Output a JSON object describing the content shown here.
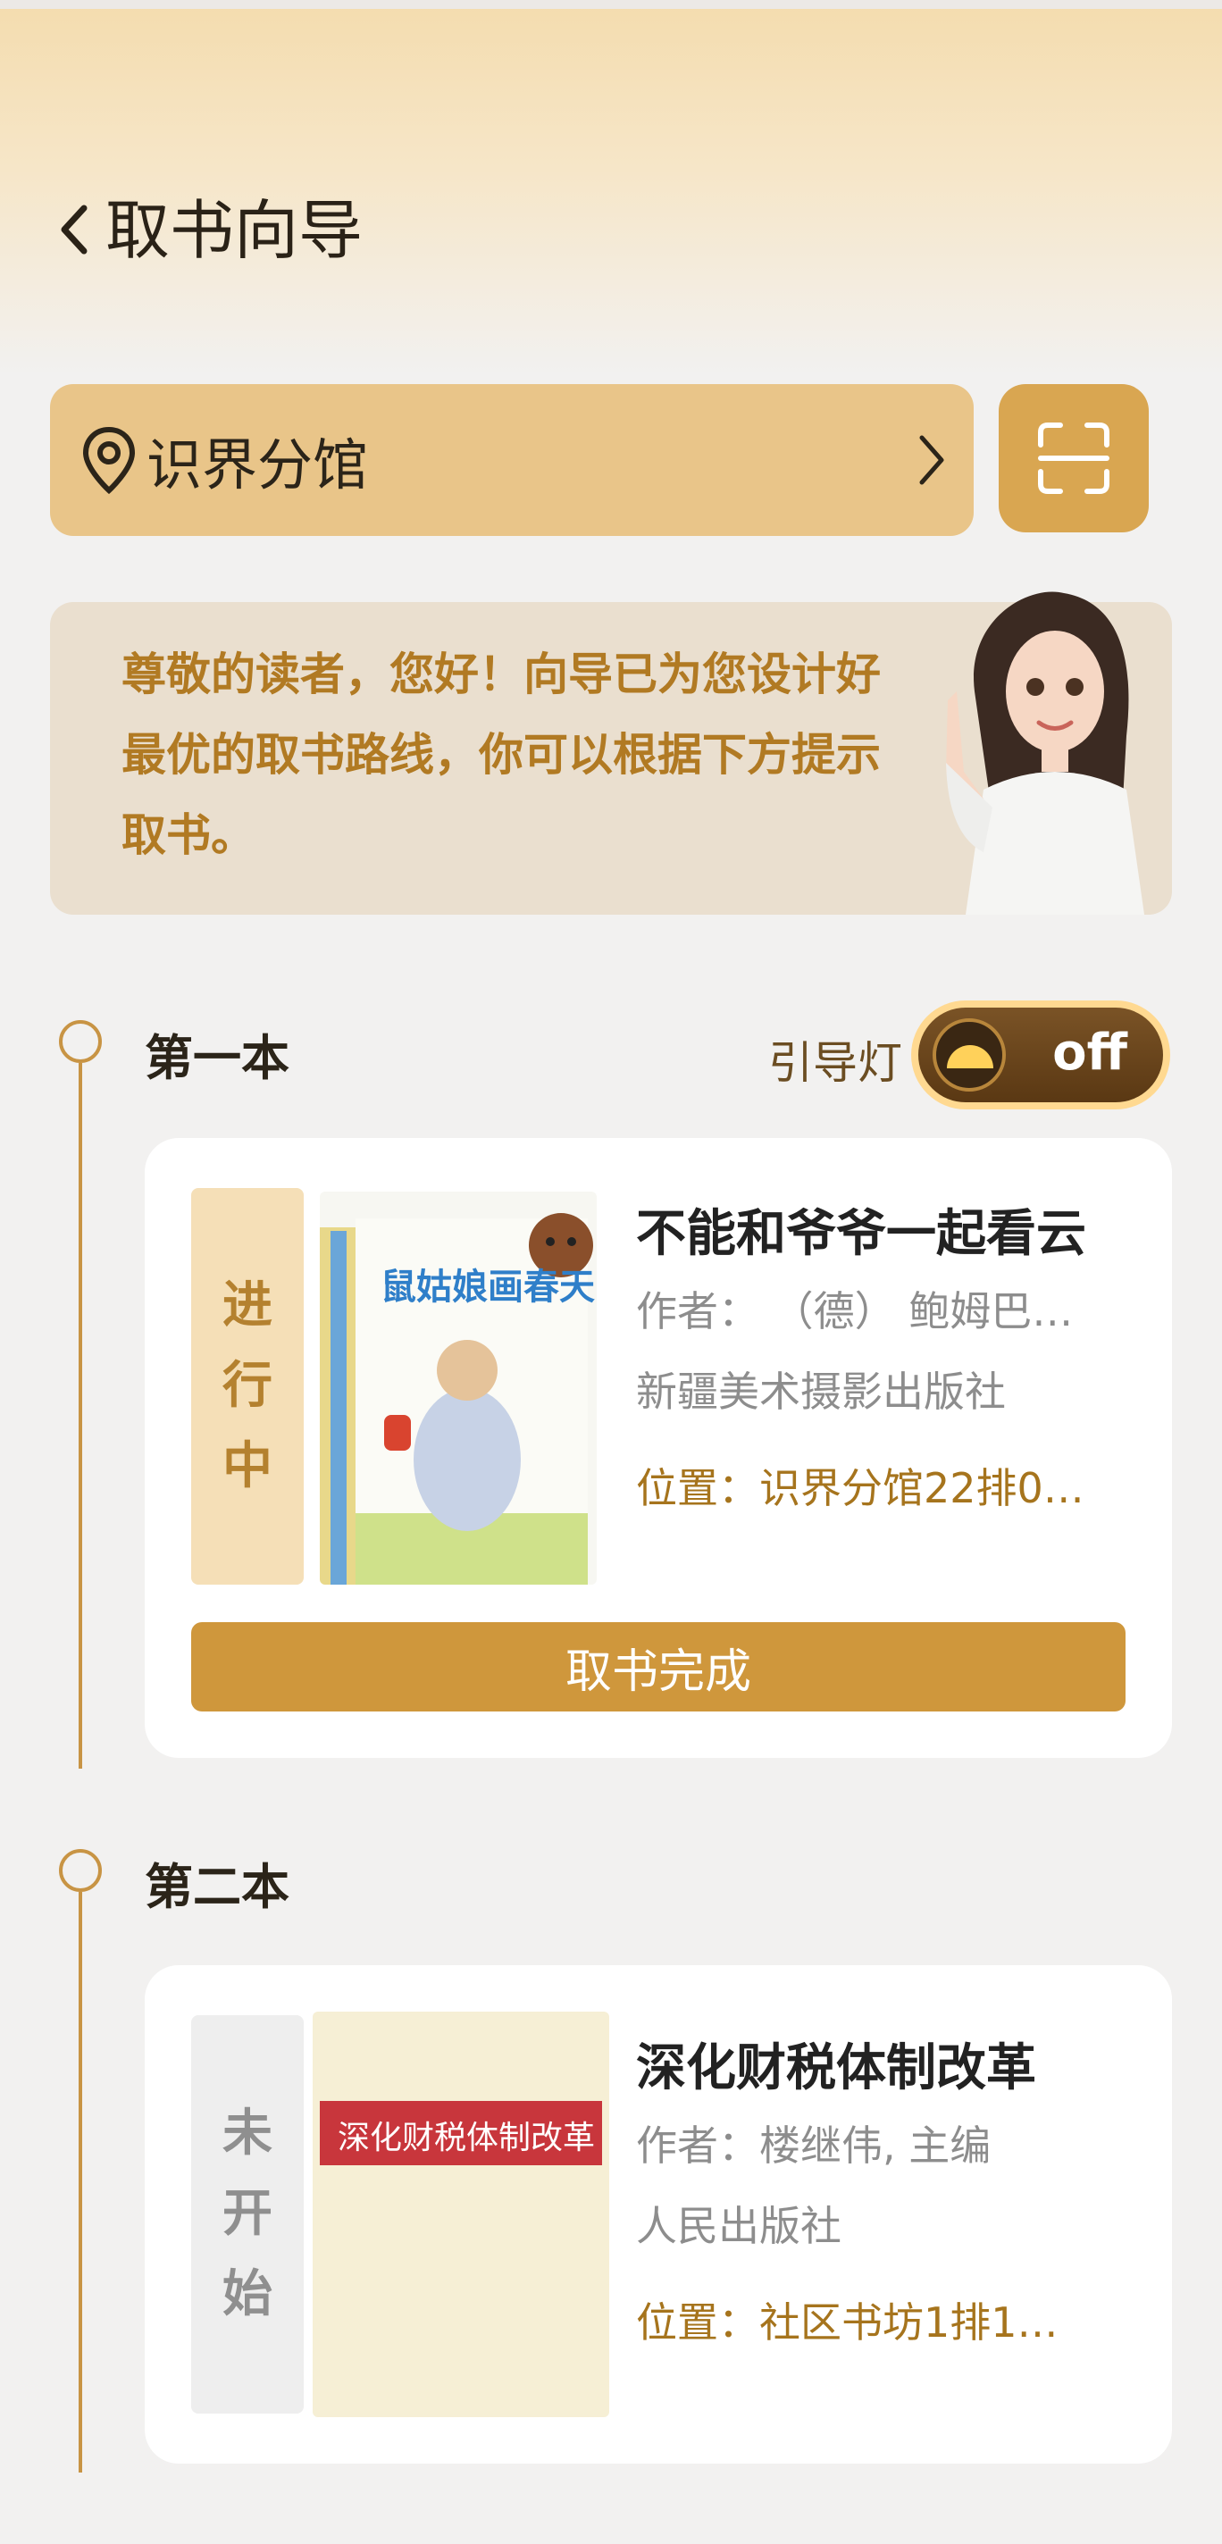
{
  "header": {
    "title": "取书向导"
  },
  "location": {
    "name": "识界分馆"
  },
  "greeting": {
    "text": "尊敬的读者，您好！向导已为您设计好最优的取书路线，你可以根据下方提示取书。"
  },
  "guide_light": {
    "label": "引导灯",
    "state": "off"
  },
  "steps": [
    {
      "title": "第一本",
      "status": [
        "进",
        "行",
        "中"
      ],
      "cover_title": "鼠姑娘画春天",
      "book_title": "不能和爷爷一起看云",
      "author": "作者： （德） 鲍姆巴…",
      "publisher": "新疆美术摄影出版社",
      "location": "位置：识界分馆22排0…",
      "button": "取书完成"
    },
    {
      "title": "第二本",
      "status": [
        "未",
        "开",
        "始"
      ],
      "cover_title": "深化财税体制改革",
      "book_title": "深化财税体制改革",
      "author": "作者：楼继伟, 主编",
      "publisher": "人民出版社",
      "location": "位置：社区书坊1排1…"
    }
  ],
  "colors": {
    "accent": "#cf973c",
    "gold_light": "#e9c589",
    "status_active_bg": "#f5dfb7"
  }
}
